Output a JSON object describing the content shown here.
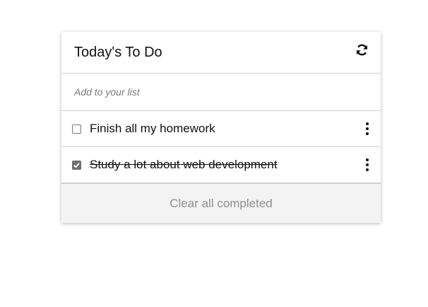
{
  "card": {
    "title": "Today's To Do",
    "refresh_icon": "refresh-icon"
  },
  "add": {
    "placeholder": "Add to your list",
    "value": ""
  },
  "items": [
    {
      "label": "Finish all my homework",
      "checked": false,
      "menu_icon": "more-vertical-icon"
    },
    {
      "label": "Study a lot about web development",
      "checked": true,
      "menu_icon": "more-vertical-icon"
    }
  ],
  "footer": {
    "clear_label": "Clear all completed"
  },
  "colors": {
    "checked_box": "#6e6e6e",
    "footer_bg": "#f3f3f3",
    "footer_text": "#8f8f8f",
    "divider": "#cfcfcf"
  }
}
